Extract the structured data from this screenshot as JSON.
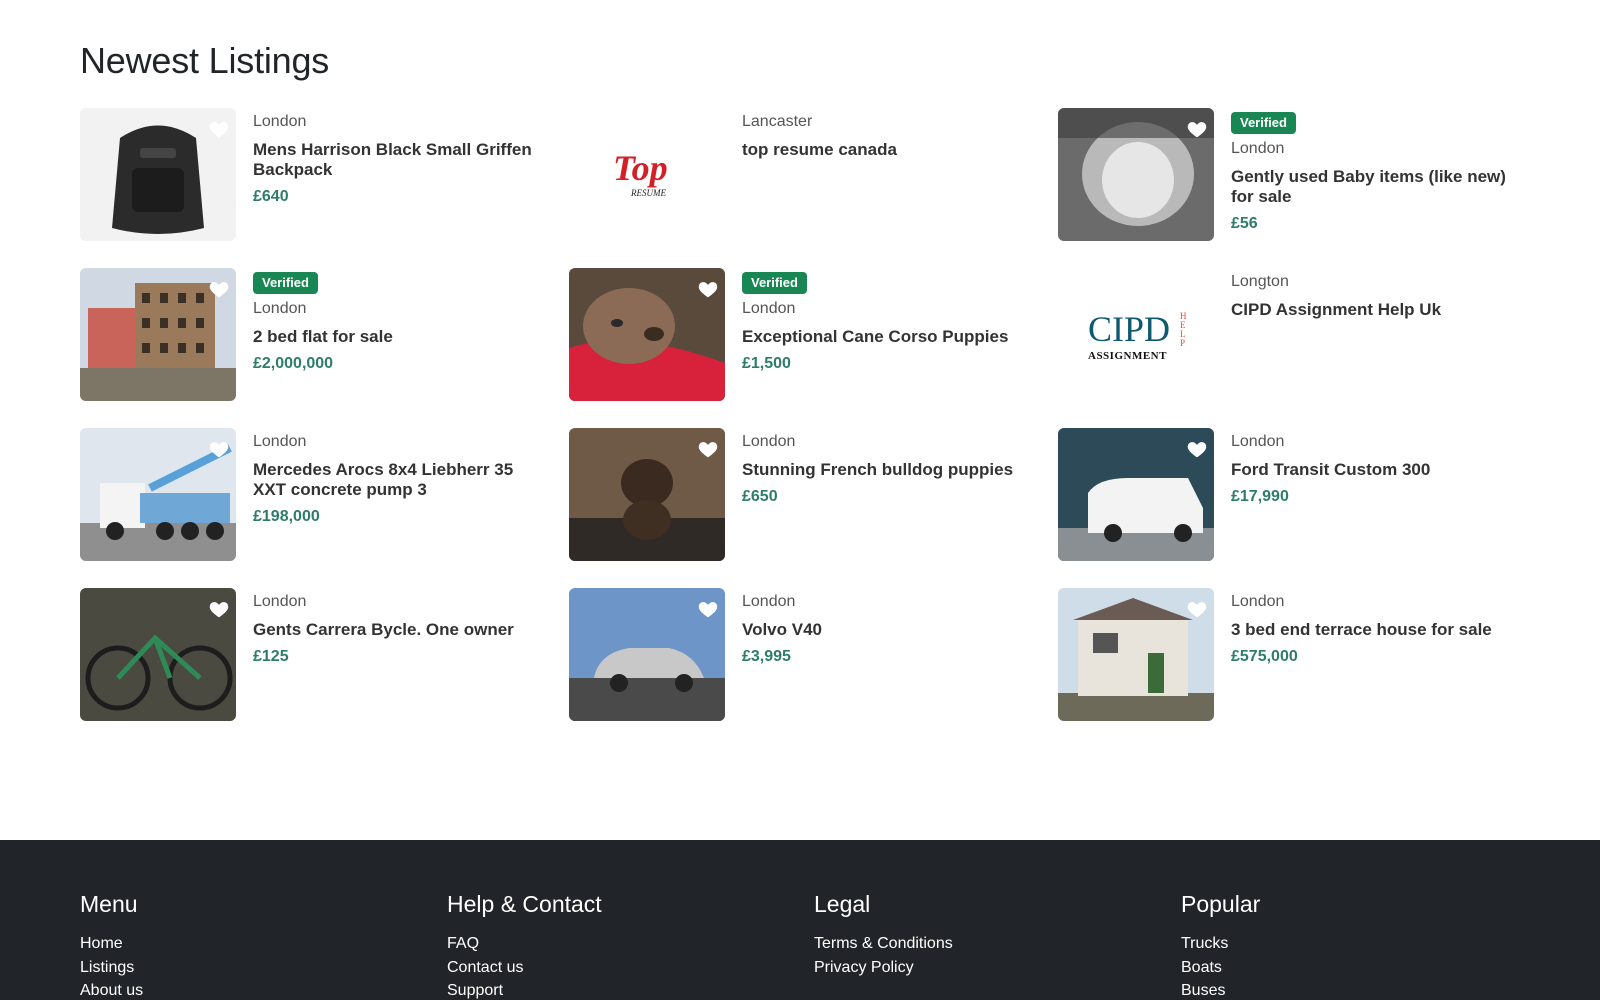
{
  "section_title": "Newest Listings",
  "listings": [
    {
      "location": "London",
      "title": "Mens Harrison Black Small Griffen Backpack",
      "price": "£640",
      "verified": false,
      "image": "backpack-photo"
    },
    {
      "location": "Lancaster",
      "title": "top resume canada",
      "price": "",
      "verified": false,
      "image": "top-resume-logo"
    },
    {
      "location": "London",
      "title": "Gently used Baby items (like new) for sale",
      "price": "£56",
      "verified": true,
      "image": "baby-carrier-photo"
    },
    {
      "location": "London",
      "title": "2 bed flat for sale",
      "price": "£2,000,000",
      "verified": true,
      "image": "riverside-building-photo"
    },
    {
      "location": "London",
      "title": "Exceptional Cane Corso Puppies",
      "price": "£1,500",
      "verified": true,
      "image": "puppy-photo"
    },
    {
      "location": "Longton",
      "title": "CIPD Assignment Help Uk",
      "price": "",
      "verified": false,
      "image": "cipd-logo"
    },
    {
      "location": "London",
      "title": "Mercedes Arocs 8x4 Liebherr 35 XXT concrete pump 3",
      "price": "£198,000",
      "verified": false,
      "image": "concrete-pump-truck-photo"
    },
    {
      "location": "London",
      "title": "Stunning French bulldog puppies",
      "price": "£650",
      "verified": false,
      "image": "bulldog-puppy-photo"
    },
    {
      "location": "London",
      "title": "Ford Transit Custom 300",
      "price": "£17,990",
      "verified": false,
      "image": "white-van-photo"
    },
    {
      "location": "London",
      "title": "Gents Carrera Bycle. One owner",
      "price": "£125",
      "verified": false,
      "image": "bicycle-photo"
    },
    {
      "location": "London",
      "title": "Volvo V40",
      "price": "£3,995",
      "verified": false,
      "image": "silver-car-photo"
    },
    {
      "location": "London",
      "title": "3 bed end terrace house for sale",
      "price": "£575,000",
      "verified": false,
      "image": "terrace-house-photo"
    }
  ],
  "badge_label": "Verified",
  "logos": {
    "top_resume": "Top",
    "top_resume_sub": "RESUME",
    "cipd": "CIPD",
    "cipd_sub": "ASSIGNMENT",
    "cipd_side": "HELP"
  },
  "footer": {
    "columns": [
      {
        "heading": "Menu",
        "links": [
          "Home",
          "Listings",
          "About us"
        ]
      },
      {
        "heading": "Help & Contact",
        "links": [
          "FAQ",
          "Contact us",
          "Support"
        ]
      },
      {
        "heading": "Legal",
        "links": [
          "Terms & Conditions",
          "Privacy Policy"
        ]
      },
      {
        "heading": "Popular",
        "links": [
          "Trucks",
          "Boats",
          "Buses"
        ]
      }
    ]
  },
  "colors": {
    "verified": "#198754",
    "price": "#2e7d6b",
    "footer_bg": "#212529"
  }
}
